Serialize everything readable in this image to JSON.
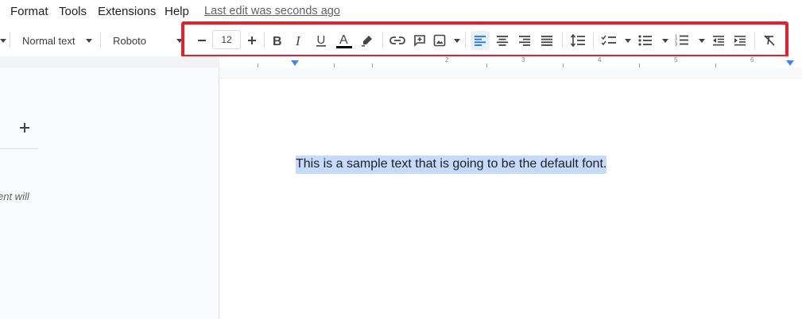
{
  "menu": {
    "items": [
      "Format",
      "Tools",
      "Extensions",
      "Help"
    ],
    "last_edit": "Last edit was seconds ago"
  },
  "toolbar": {
    "style_value": "Normal text",
    "font_value": "Roboto",
    "font_size": "12",
    "icons": {
      "decrease": "minus-icon",
      "increase": "plus-icon",
      "bold": "bold-icon",
      "italic": "italic-icon",
      "underline": "underline-icon",
      "text_color": "text-color-icon",
      "highlight": "highlighter-icon",
      "link": "link-icon",
      "comment": "add-comment-icon",
      "image": "image-icon",
      "align_left": "align-left-icon",
      "align_center": "align-center-icon",
      "align_right": "align-right-icon",
      "justify": "justify-icon",
      "line_spacing": "line-spacing-icon",
      "checklist": "checklist-icon",
      "bullets": "bulleted-list-icon",
      "numbered": "numbered-list-icon",
      "outdent": "decrease-indent-icon",
      "indent": "increase-indent-icon",
      "clear_format": "clear-formatting-icon"
    },
    "highlight_color": "#e81f2b",
    "active_color": "#1a73e8"
  },
  "ruler": {
    "labels": [
      "1",
      "2",
      "3",
      "4",
      "5",
      "6"
    ]
  },
  "outline": {
    "hint": "ent will"
  },
  "document": {
    "text": "This is a sample text that is going to be the default font."
  }
}
